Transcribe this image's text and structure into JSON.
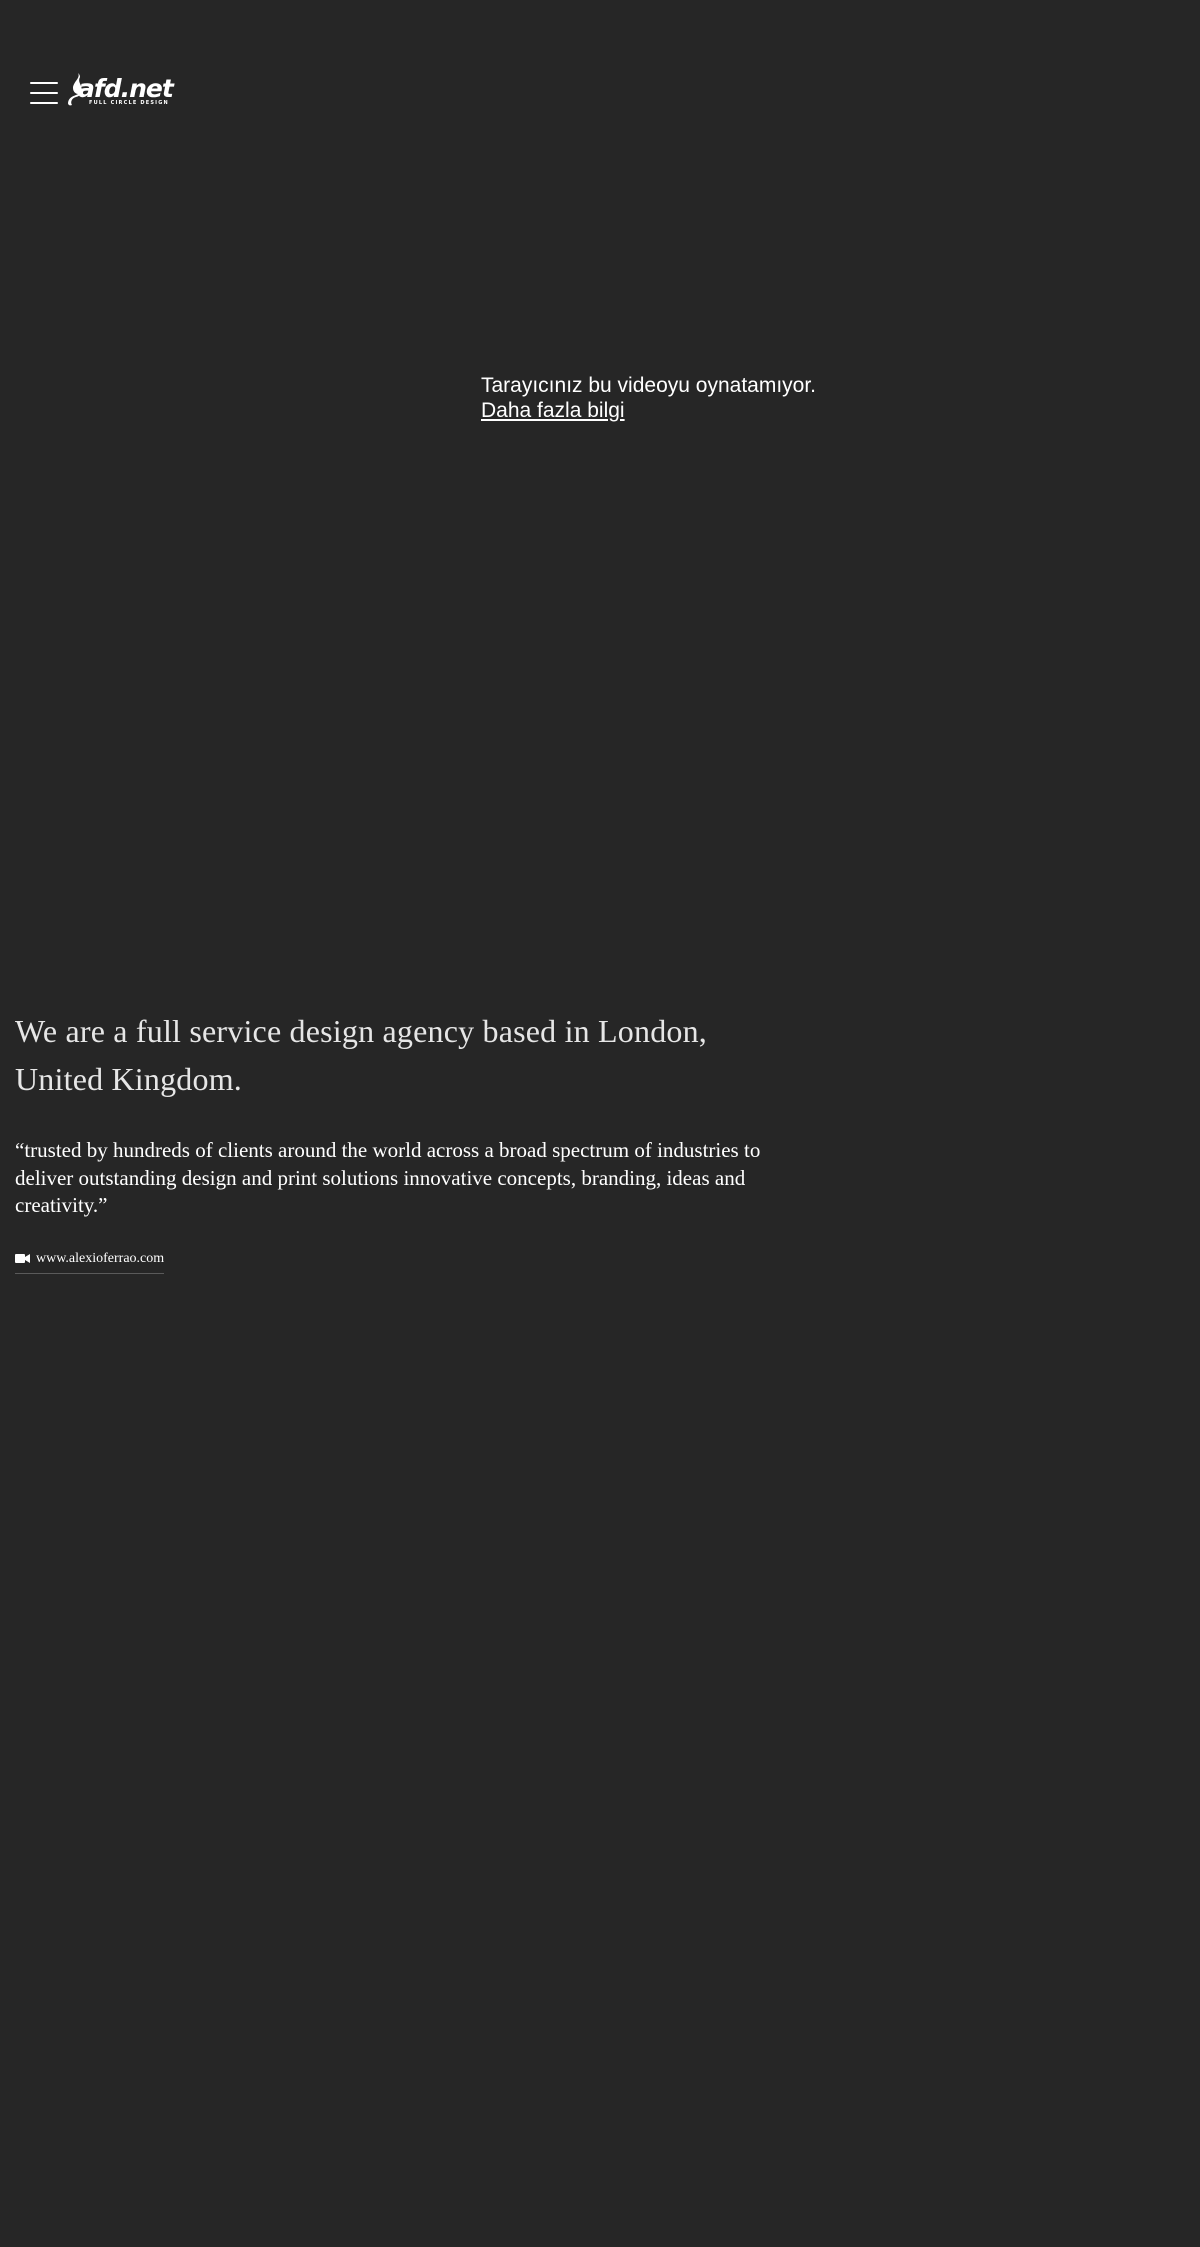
{
  "header": {
    "logo_text": "afd.net",
    "logo_tagline": "FULL CIRCLE DESIGN",
    "menu_icon": "hamburger-menu-icon"
  },
  "video": {
    "fallback_message": "Tarayıcınız bu videoyu oynatamıyor.",
    "fallback_link": "Daha fazla bilgi"
  },
  "hero": {
    "headline": "We are a full service design agency based in London, United Kingdom.",
    "quote": "“trusted by hundreds of clients around the world across a broad spectrum of industries to deliver outstanding design and print solutions innovative concepts, branding, ideas and creativity.”",
    "credit_icon": "video-camera-icon",
    "credit_link": "www.alexioferrao.com"
  },
  "colors": {
    "background": "#262626",
    "text": "#ffffff",
    "headline": "#e6e6e6"
  }
}
